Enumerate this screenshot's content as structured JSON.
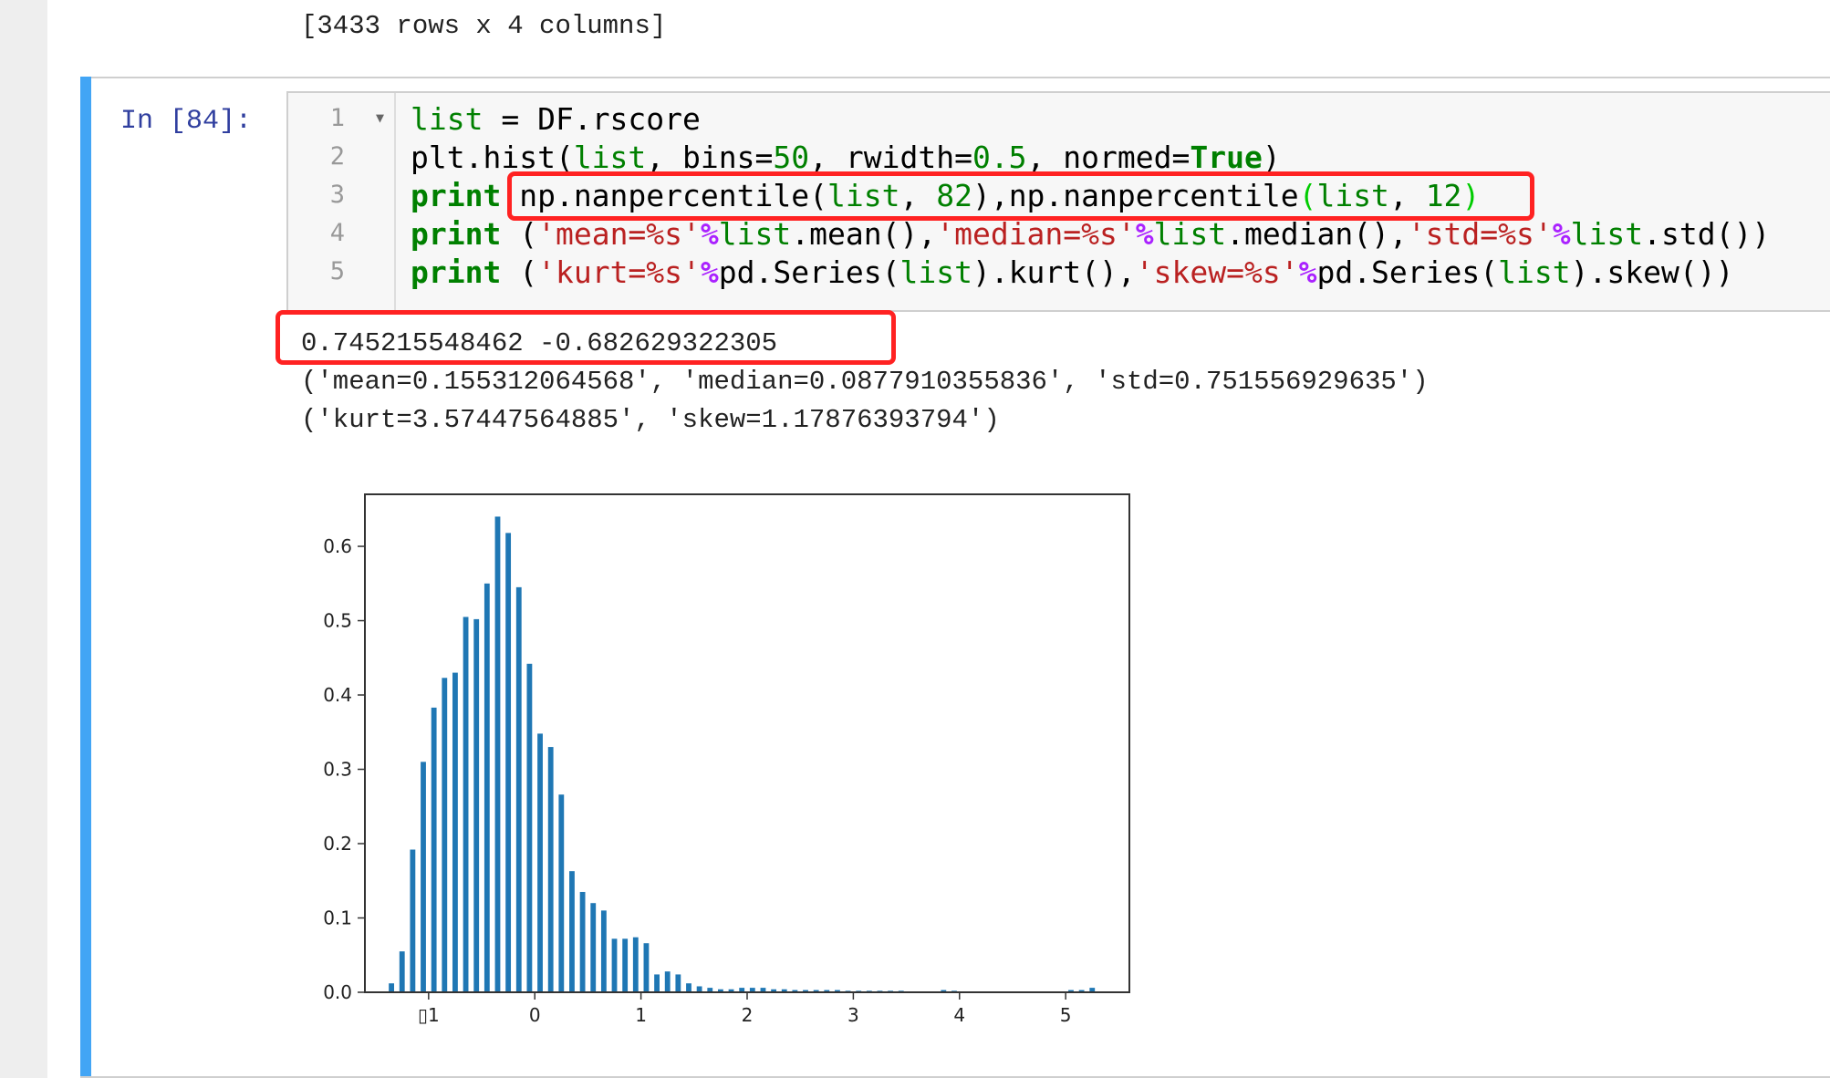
{
  "previous_output": "[3433 rows x 4 columns]",
  "cell": {
    "prompt": "In [84]:",
    "line_numbers": [
      "1",
      "2",
      "3",
      "4",
      "5"
    ],
    "code": [
      [
        {
          "t": "",
          "c": "nb",
          "v": "list"
        },
        {
          "c": "",
          "v": " = DF.rscore"
        }
      ],
      [
        {
          "c": "",
          "v": "plt.hist("
        },
        {
          "c": "nb",
          "v": "list"
        },
        {
          "c": "",
          "v": ", bins="
        },
        {
          "c": "num",
          "v": "50"
        },
        {
          "c": "",
          "v": ", rwidth="
        },
        {
          "c": "num",
          "v": "0.5"
        },
        {
          "c": "",
          "v": ", normed="
        },
        {
          "c": "kw",
          "v": "True"
        },
        {
          "c": "",
          "v": ")"
        }
      ],
      [
        {
          "c": "kw",
          "v": "print"
        },
        {
          "c": "",
          "v": " np.nanpercentile("
        },
        {
          "c": "nb",
          "v": "list"
        },
        {
          "c": "",
          "v": ", "
        },
        {
          "c": "num",
          "v": "82"
        },
        {
          "c": "",
          "v": "),np.nanpercentile"
        },
        {
          "c": "br",
          "v": "("
        },
        {
          "c": "nb",
          "v": "list"
        },
        {
          "c": "",
          "v": ", "
        },
        {
          "c": "num",
          "v": "12"
        },
        {
          "c": "br",
          "v": ")"
        }
      ],
      [
        {
          "c": "kw",
          "v": "print"
        },
        {
          "c": "",
          "v": " ("
        },
        {
          "c": "str",
          "v": "'mean=%s'"
        },
        {
          "c": "op",
          "v": "%"
        },
        {
          "c": "nb",
          "v": "list"
        },
        {
          "c": "",
          "v": ".mean(),"
        },
        {
          "c": "str",
          "v": "'median=%s'"
        },
        {
          "c": "op",
          "v": "%"
        },
        {
          "c": "nb",
          "v": "list"
        },
        {
          "c": "",
          "v": ".median(),"
        },
        {
          "c": "str",
          "v": "'std=%s'"
        },
        {
          "c": "op",
          "v": "%"
        },
        {
          "c": "nb",
          "v": "list"
        },
        {
          "c": "",
          "v": ".std())"
        }
      ],
      [
        {
          "c": "kw",
          "v": "print"
        },
        {
          "c": "",
          "v": " ("
        },
        {
          "c": "str",
          "v": "'kurt=%s'"
        },
        {
          "c": "op",
          "v": "%"
        },
        {
          "c": "",
          "v": "pd.Series("
        },
        {
          "c": "nb",
          "v": "list"
        },
        {
          "c": "",
          "v": ").kurt(),"
        },
        {
          "c": "str",
          "v": "'skew=%s'"
        },
        {
          "c": "op",
          "v": "%"
        },
        {
          "c": "",
          "v": "pd.Series("
        },
        {
          "c": "nb",
          "v": "list"
        },
        {
          "c": "",
          "v": ").skew())"
        }
      ]
    ]
  },
  "output_lines": [
    "0.745215548462 -0.682629322305",
    "('mean=0.155312064568', 'median=0.0877910355836', 'std=0.751556929635')",
    "('kurt=3.57447564885', 'skew=1.17876393794')"
  ],
  "colors": {
    "bar": "#1f77b4",
    "highlight": "#ff2222",
    "cell_selected": "#42a5f5"
  },
  "chart_data": {
    "type": "bar",
    "x": [
      -1.35,
      -1.25,
      -1.15,
      -1.05,
      -0.95,
      -0.85,
      -0.75,
      -0.65,
      -0.55,
      -0.45,
      -0.35,
      -0.25,
      -0.15,
      -0.05,
      0.05,
      0.15,
      0.25,
      0.35,
      0.45,
      0.55,
      0.65,
      0.75,
      0.85,
      0.95,
      1.05,
      1.15,
      1.25,
      1.35,
      1.45,
      1.55,
      1.65,
      1.75,
      1.85,
      1.95,
      2.05,
      2.15,
      2.25,
      2.35,
      2.45,
      2.55,
      2.65,
      2.75,
      2.85,
      2.95,
      3.05,
      3.15,
      3.25,
      3.35,
      3.45,
      3.55,
      3.65,
      3.75,
      3.85,
      3.95,
      4.05,
      4.15,
      4.25,
      4.35,
      4.45,
      4.55,
      4.65,
      4.75,
      4.85,
      4.95,
      5.05,
      5.15,
      5.25
    ],
    "values": [
      0.012,
      0.055,
      0.192,
      0.31,
      0.383,
      0.423,
      0.43,
      0.505,
      0.502,
      0.55,
      0.64,
      0.618,
      0.545,
      0.442,
      0.348,
      0.33,
      0.266,
      0.163,
      0.135,
      0.12,
      0.11,
      0.072,
      0.072,
      0.074,
      0.066,
      0.024,
      0.028,
      0.024,
      0.012,
      0.008,
      0.006,
      0.004,
      0.004,
      0.006,
      0.006,
      0.006,
      0.004,
      0.004,
      0.003,
      0.003,
      0.003,
      0.003,
      0.003,
      0.002,
      0.002,
      0.002,
      0.002,
      0.002,
      0.002,
      0.001,
      0.001,
      0.001,
      0.003,
      0.002,
      0.001,
      0.001,
      0.001,
      0.001,
      0.001,
      0.001,
      0.001,
      0.001,
      0.001,
      0.001,
      0.003,
      0.003,
      0.006
    ],
    "xlim": [
      -1.6,
      5.6
    ],
    "ylim": [
      0,
      0.67
    ],
    "xticks": [
      {
        "v": -1,
        "label": "▯1"
      },
      {
        "v": 0,
        "label": "0"
      },
      {
        "v": 1,
        "label": "1"
      },
      {
        "v": 2,
        "label": "2"
      },
      {
        "v": 3,
        "label": "3"
      },
      {
        "v": 4,
        "label": "4"
      },
      {
        "v": 5,
        "label": "5"
      }
    ],
    "yticks": [
      {
        "v": 0.0,
        "label": "0.0"
      },
      {
        "v": 0.1,
        "label": "0.1"
      },
      {
        "v": 0.2,
        "label": "0.2"
      },
      {
        "v": 0.3,
        "label": "0.3"
      },
      {
        "v": 0.4,
        "label": "0.4"
      },
      {
        "v": 0.5,
        "label": "0.5"
      },
      {
        "v": 0.6,
        "label": "0.6"
      }
    ],
    "bar_width": 0.05,
    "grid": false
  }
}
